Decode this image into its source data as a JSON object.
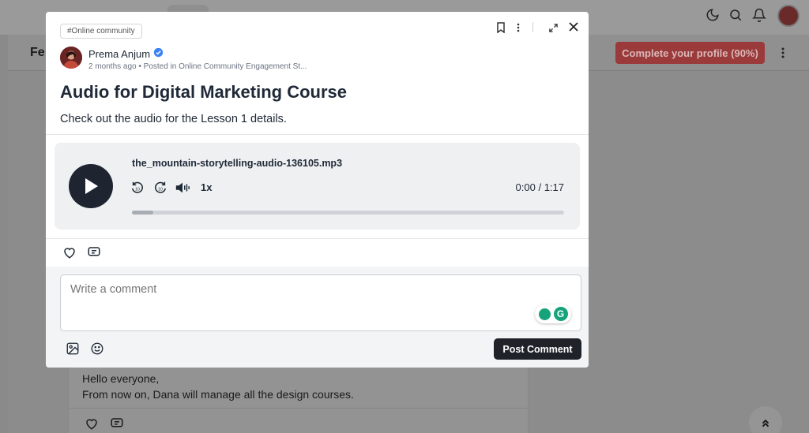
{
  "background": {
    "feed_title_partial": "Fe",
    "complete_profile_label": "Complete your profile (90%)",
    "post_text_line1": "Hello everyone,",
    "post_text_line2": "From now on, Dana will manage all the design courses."
  },
  "modal": {
    "tag": "#Online community",
    "author": {
      "name": "Prema Anjum",
      "verified": true,
      "meta": "2 months ago • Posted in Online Community Engagement St..."
    },
    "title": "Audio for Digital Marketing Course",
    "description": "Check out the audio for the Lesson 1 details.",
    "audio": {
      "filename": "the_mountain-storytelling-audio-136105.mp3",
      "speed": "1x",
      "current_time": "0:00",
      "separator": "/",
      "duration": "1:17",
      "progress_fraction": 0.05
    },
    "comment": {
      "placeholder": "Write a comment",
      "post_label": "Post Comment"
    }
  },
  "colors": {
    "accent_dark": "#1f2329",
    "verified_blue": "#3b82f6",
    "grammarly_green": "#15a37b"
  }
}
